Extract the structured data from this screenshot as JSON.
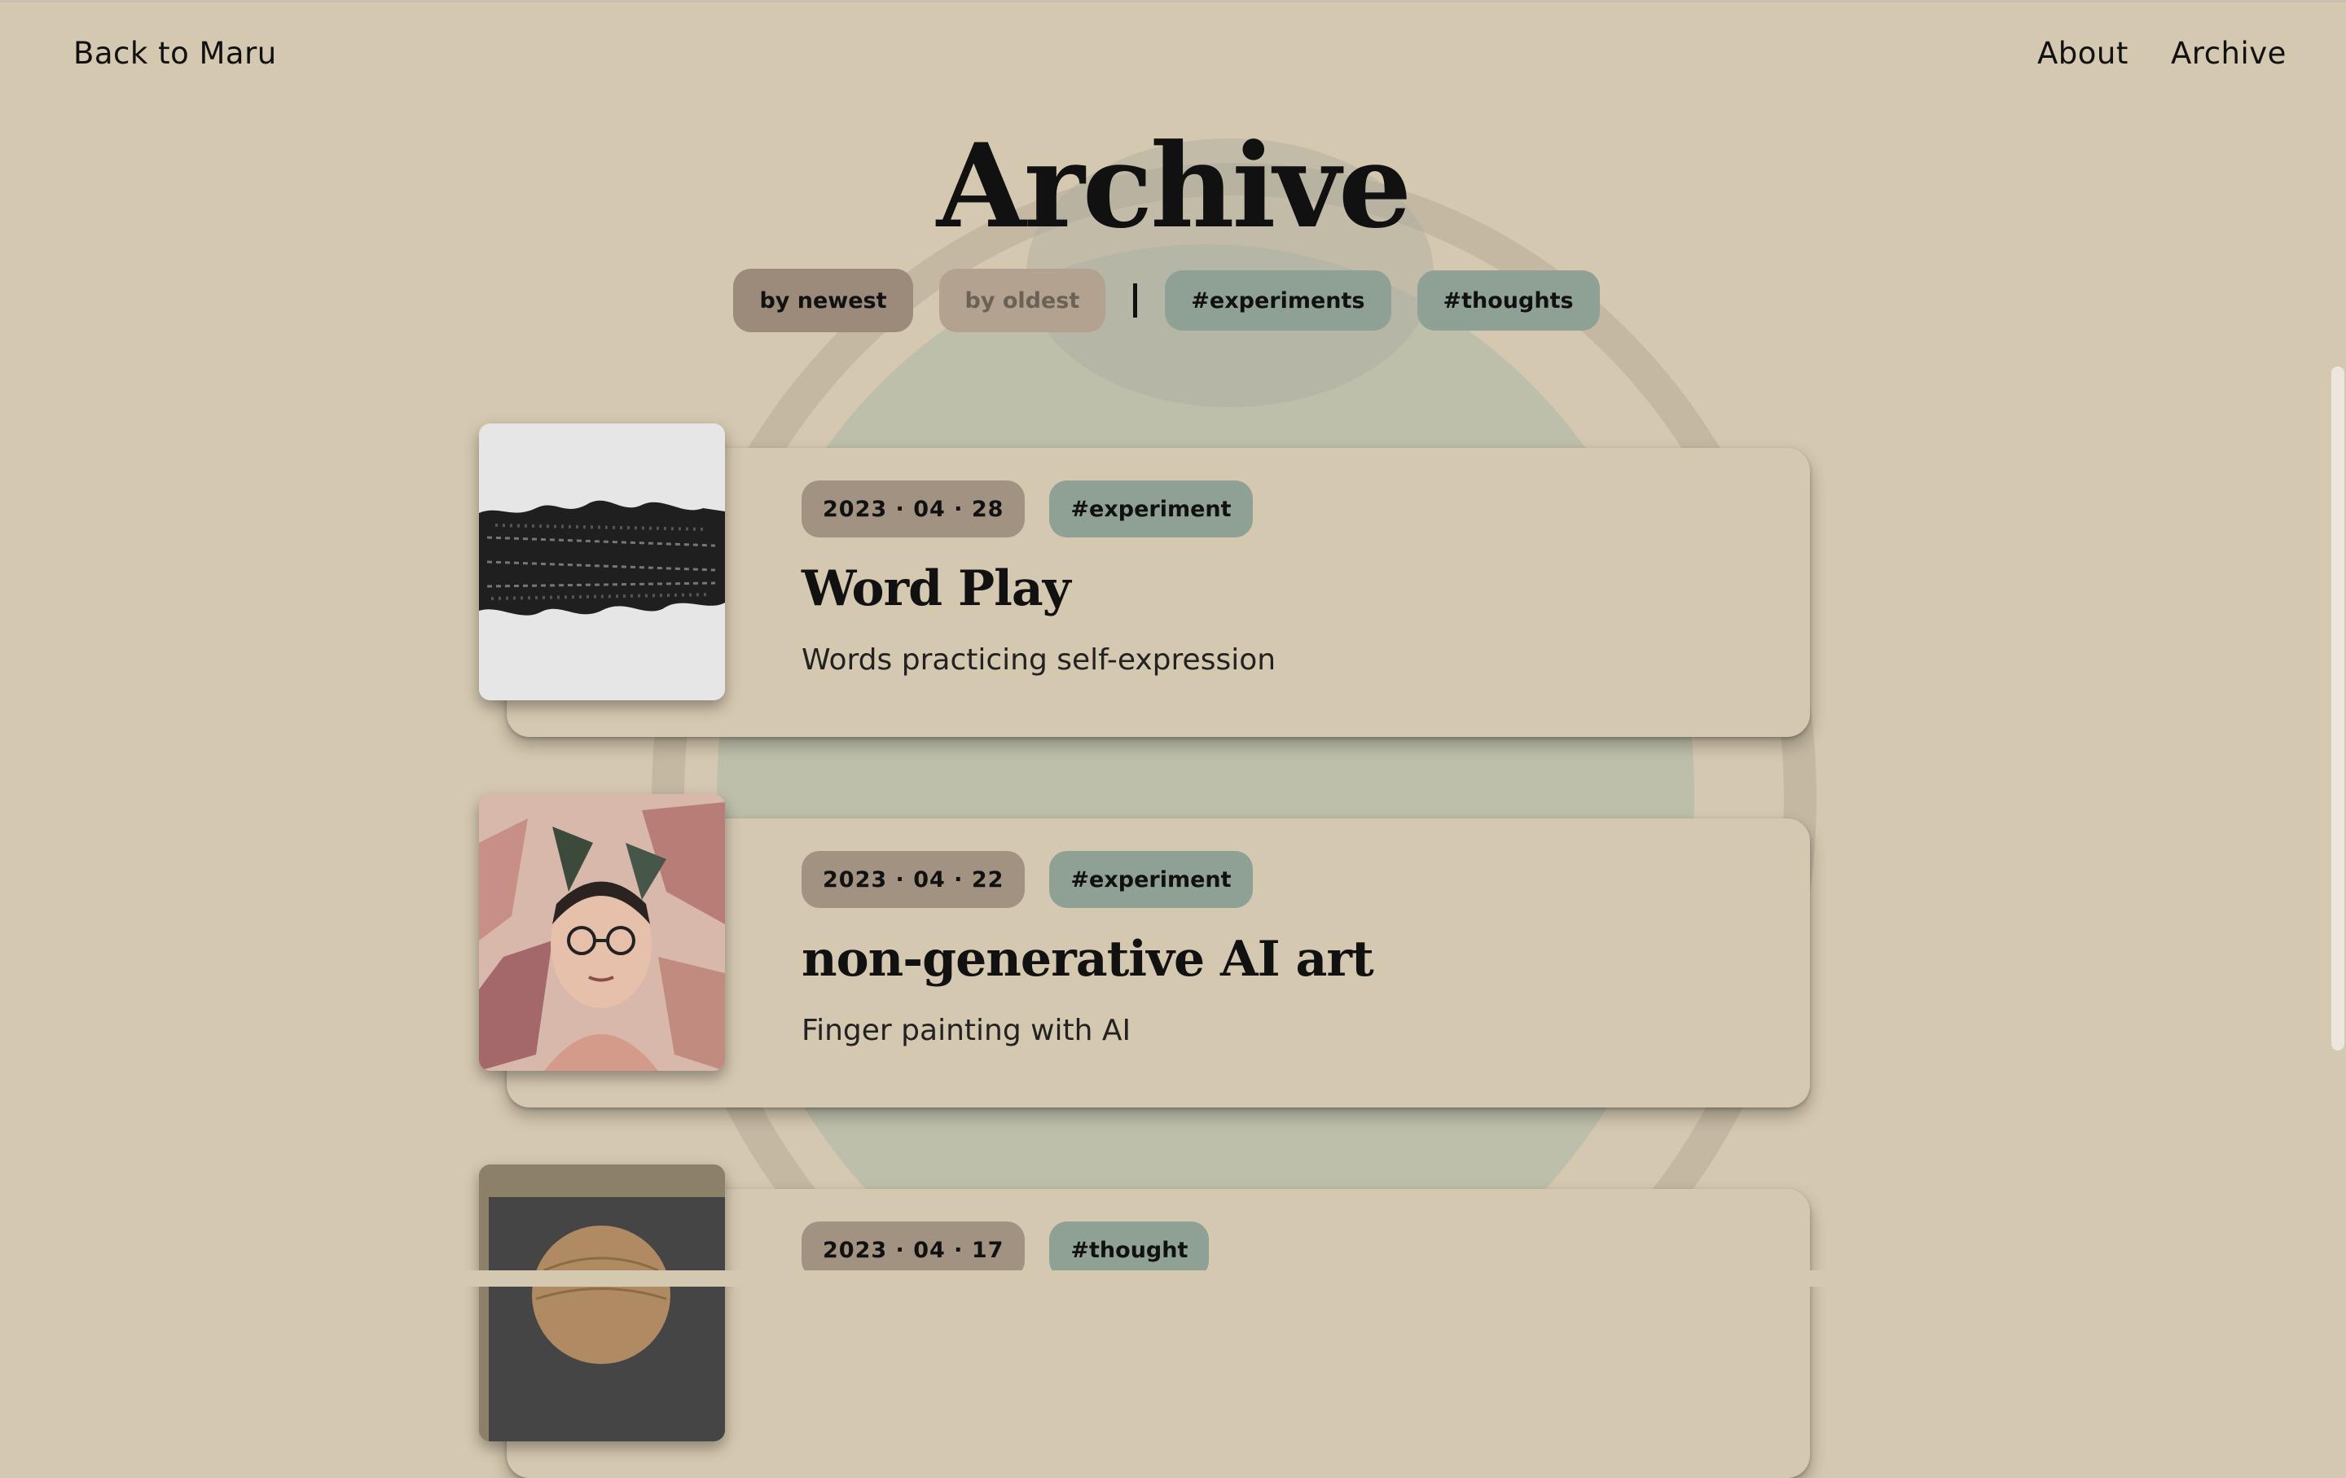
{
  "nav": {
    "back_label": "Back to Maru",
    "about_label": "About",
    "archive_label": "Archive"
  },
  "page": {
    "title": "Archive"
  },
  "filters": {
    "newest_label": "by newest",
    "oldest_label": "by oldest",
    "active_sort": "by newest",
    "tags": [
      "#experiments",
      "#thoughts"
    ]
  },
  "posts": [
    {
      "date": "2023 · 04 · 28",
      "tag": "#experiment",
      "title": "Word Play",
      "description": "Words practicing self-expression"
    },
    {
      "date": "2023 · 04 · 22",
      "tag": "#experiment",
      "title": "non-generative AI art",
      "description": "Finger painting with AI"
    },
    {
      "date": "2023 · 04 · 17",
      "tag": "#thought",
      "title": "",
      "description": ""
    }
  ],
  "colors": {
    "background": "#d5c8b0",
    "chip_newest": "#9c8b7b",
    "chip_tag": "#8fa195",
    "date_badge": "#a19282"
  }
}
